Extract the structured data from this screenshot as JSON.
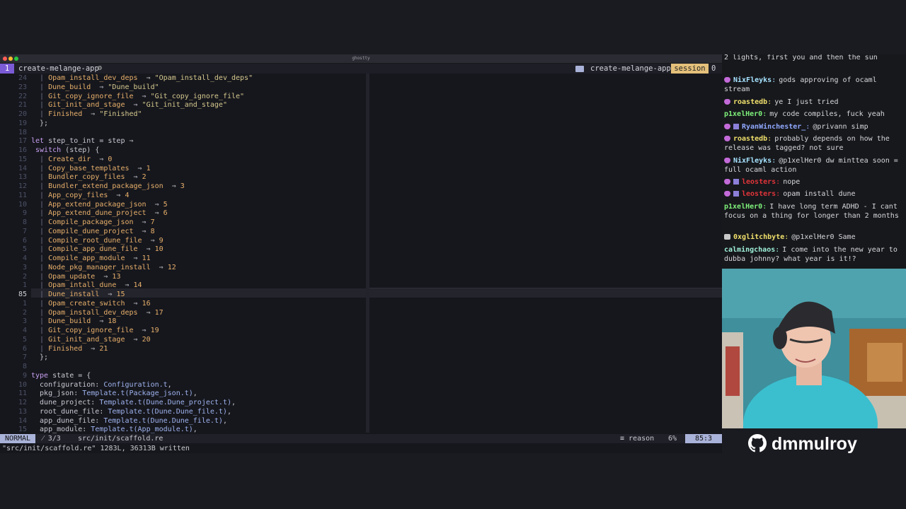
{
  "window": {
    "title": "ghostty"
  },
  "tmux": {
    "window_index": "1",
    "window_name": "create-melange-app",
    "right_name": "create-melange-app",
    "session_label": "session",
    "session_number": "0"
  },
  "editor": {
    "lines": [
      {
        "ln": "24",
        "segs": [
          [
            "pipe",
            "  | "
          ],
          [
            "ctor",
            "Opam_install_dev_deps"
          ],
          [
            "",
            "  ⇒ "
          ],
          [
            "str",
            "\"Opam_install_dev_deps\""
          ]
        ]
      },
      {
        "ln": "23",
        "segs": [
          [
            "pipe",
            "  | "
          ],
          [
            "ctor",
            "Dune_build"
          ],
          [
            "",
            "  ⇒ "
          ],
          [
            "str",
            "\"Dune_build\""
          ]
        ]
      },
      {
        "ln": "22",
        "segs": [
          [
            "pipe",
            "  | "
          ],
          [
            "ctor",
            "Git_copy_ignore_file"
          ],
          [
            "",
            "  ⇒ "
          ],
          [
            "str",
            "\"Git_copy_ignore_file\""
          ]
        ]
      },
      {
        "ln": "21",
        "segs": [
          [
            "pipe",
            "  | "
          ],
          [
            "ctor",
            "Git_init_and_stage"
          ],
          [
            "",
            "  ⇒ "
          ],
          [
            "str",
            "\"Git_init_and_stage\""
          ]
        ]
      },
      {
        "ln": "20",
        "segs": [
          [
            "pipe",
            "  | "
          ],
          [
            "ctor",
            "Finished"
          ],
          [
            "",
            "  ⇒ "
          ],
          [
            "str",
            "\"Finished\""
          ]
        ]
      },
      {
        "ln": "19",
        "segs": [
          [
            "",
            "  };"
          ]
        ]
      },
      {
        "ln": "18",
        "segs": [
          [
            "",
            ""
          ]
        ]
      },
      {
        "ln": "17",
        "segs": [
          [
            "kw",
            "let "
          ],
          [
            "",
            "step_to_int = step ⇒"
          ]
        ]
      },
      {
        "ln": "16",
        "segs": [
          [
            "kw",
            " switch"
          ],
          [
            "",
            " (step) {"
          ]
        ]
      },
      {
        "ln": "15",
        "segs": [
          [
            "pipe",
            "  | "
          ],
          [
            "ctor",
            "Create_dir"
          ],
          [
            "",
            "  ⇒ "
          ],
          [
            "num",
            "0"
          ]
        ]
      },
      {
        "ln": "14",
        "segs": [
          [
            "pipe",
            "  | "
          ],
          [
            "ctor",
            "Copy_base_templates"
          ],
          [
            "",
            "  ⇒ "
          ],
          [
            "num",
            "1"
          ]
        ]
      },
      {
        "ln": "13",
        "segs": [
          [
            "pipe",
            "  | "
          ],
          [
            "ctor",
            "Bundler_copy_files"
          ],
          [
            "",
            "  ⇒ "
          ],
          [
            "num",
            "2"
          ]
        ]
      },
      {
        "ln": "12",
        "segs": [
          [
            "pipe",
            "  | "
          ],
          [
            "ctor",
            "Bundler_extend_package_json"
          ],
          [
            "",
            "  ⇒ "
          ],
          [
            "num",
            "3"
          ]
        ]
      },
      {
        "ln": "11",
        "segs": [
          [
            "pipe",
            "  | "
          ],
          [
            "ctor",
            "App_copy_files"
          ],
          [
            "",
            "  ⇒ "
          ],
          [
            "num",
            "4"
          ]
        ]
      },
      {
        "ln": "10",
        "segs": [
          [
            "pipe",
            "  | "
          ],
          [
            "ctor",
            "App_extend_package_json"
          ],
          [
            "",
            "  ⇒ "
          ],
          [
            "num",
            "5"
          ]
        ]
      },
      {
        "ln": "9",
        "segs": [
          [
            "pipe",
            "  | "
          ],
          [
            "ctor",
            "App_extend_dune_project"
          ],
          [
            "",
            "  ⇒ "
          ],
          [
            "num",
            "6"
          ]
        ]
      },
      {
        "ln": "8",
        "segs": [
          [
            "pipe",
            "  | "
          ],
          [
            "ctor",
            "Compile_package_json"
          ],
          [
            "",
            "  ⇒ "
          ],
          [
            "num",
            "7"
          ]
        ]
      },
      {
        "ln": "7",
        "segs": [
          [
            "pipe",
            "  | "
          ],
          [
            "ctor",
            "Compile_dune_project"
          ],
          [
            "",
            "  ⇒ "
          ],
          [
            "num",
            "8"
          ]
        ]
      },
      {
        "ln": "6",
        "segs": [
          [
            "pipe",
            "  | "
          ],
          [
            "ctor",
            "Compile_root_dune_file"
          ],
          [
            "",
            "  ⇒ "
          ],
          [
            "num",
            "9"
          ]
        ]
      },
      {
        "ln": "5",
        "segs": [
          [
            "pipe",
            "  | "
          ],
          [
            "ctor",
            "Compile_app_dune_file"
          ],
          [
            "",
            "  ⇒ "
          ],
          [
            "num",
            "10"
          ]
        ]
      },
      {
        "ln": "4",
        "segs": [
          [
            "pipe",
            "  | "
          ],
          [
            "ctor",
            "Compile_app_module"
          ],
          [
            "",
            "  ⇒ "
          ],
          [
            "num",
            "11"
          ]
        ]
      },
      {
        "ln": "3",
        "segs": [
          [
            "pipe",
            "  | "
          ],
          [
            "ctor",
            "Node_pkg_manager_install"
          ],
          [
            "",
            "  ⇒ "
          ],
          [
            "num",
            "12"
          ]
        ]
      },
      {
        "ln": "2",
        "segs": [
          [
            "pipe",
            "  | "
          ],
          [
            "ctor",
            "Opam_update"
          ],
          [
            "",
            "  ⇒ "
          ],
          [
            "num",
            "13"
          ]
        ]
      },
      {
        "ln": "1",
        "segs": [
          [
            "pipe",
            "  | "
          ],
          [
            "ctor",
            "Opam_intall_dune"
          ],
          [
            "",
            "  ⇒ "
          ],
          [
            "num",
            "14"
          ]
        ]
      },
      {
        "ln": "85",
        "cur": true,
        "segs": [
          [
            "pipe",
            "  | "
          ],
          [
            "ctor",
            "Dune_install"
          ],
          [
            "",
            "  ⇒ "
          ],
          [
            "num",
            "15"
          ]
        ]
      },
      {
        "ln": "1",
        "segs": [
          [
            "pipe",
            "  | "
          ],
          [
            "ctor",
            "Opam_create_switch"
          ],
          [
            "",
            "  ⇒ "
          ],
          [
            "num",
            "16"
          ]
        ]
      },
      {
        "ln": "2",
        "segs": [
          [
            "pipe",
            "  | "
          ],
          [
            "ctor",
            "Opam_install_dev_deps"
          ],
          [
            "",
            "  ⇒ "
          ],
          [
            "num",
            "17"
          ]
        ]
      },
      {
        "ln": "3",
        "segs": [
          [
            "pipe",
            "  | "
          ],
          [
            "ctor",
            "Dune_build"
          ],
          [
            "",
            "  ⇒ "
          ],
          [
            "num",
            "18"
          ]
        ]
      },
      {
        "ln": "4",
        "segs": [
          [
            "pipe",
            "  | "
          ],
          [
            "ctor",
            "Git_copy_ignore_file"
          ],
          [
            "",
            "  ⇒ "
          ],
          [
            "num",
            "19"
          ]
        ]
      },
      {
        "ln": "5",
        "segs": [
          [
            "pipe",
            "  | "
          ],
          [
            "ctor",
            "Git_init_and_stage"
          ],
          [
            "",
            "  ⇒ "
          ],
          [
            "num",
            "20"
          ]
        ]
      },
      {
        "ln": "6",
        "segs": [
          [
            "pipe",
            "  | "
          ],
          [
            "ctor",
            "Finished"
          ],
          [
            "",
            "  ⇒ "
          ],
          [
            "num",
            "21"
          ]
        ]
      },
      {
        "ln": "7",
        "segs": [
          [
            "",
            "  };"
          ]
        ]
      },
      {
        "ln": "8",
        "segs": [
          [
            "",
            ""
          ]
        ]
      },
      {
        "ln": "9",
        "segs": [
          [
            "kw",
            "type "
          ],
          [
            "",
            "state = {"
          ]
        ]
      },
      {
        "ln": "10",
        "segs": [
          [
            "",
            "  configuration: "
          ],
          [
            "mod",
            "Configuration.t"
          ],
          [
            "",
            ","
          ]
        ]
      },
      {
        "ln": "11",
        "segs": [
          [
            "",
            "  pkg_json: "
          ],
          [
            "mod",
            "Template.t(Package_json.t)"
          ],
          [
            "",
            ","
          ]
        ]
      },
      {
        "ln": "12",
        "segs": [
          [
            "",
            "  dune_project: "
          ],
          [
            "mod",
            "Template.t(Dune.Dune_project.t)"
          ],
          [
            "",
            ","
          ]
        ]
      },
      {
        "ln": "13",
        "segs": [
          [
            "",
            "  root_dune_file: "
          ],
          [
            "mod",
            "Template.t(Dune.Dune_file.t)"
          ],
          [
            "",
            ","
          ]
        ]
      },
      {
        "ln": "14",
        "segs": [
          [
            "",
            "  app_dune_file: "
          ],
          [
            "mod",
            "Template.t(Dune.Dune_file.t)"
          ],
          [
            "",
            ","
          ]
        ]
      },
      {
        "ln": "15",
        "segs": [
          [
            "",
            "  app_module: "
          ],
          [
            "mod",
            "Template.t(App_module.t)"
          ],
          [
            "",
            ","
          ]
        ]
      }
    ]
  },
  "statusline": {
    "mode": "NORMAL",
    "branch": "⁄ 3/3",
    "file": "src/init/scaffold.re",
    "filetype": "≡ reason",
    "percent": "6%",
    "position": "85:3"
  },
  "cmdline": "\"src/init/scaffold.re\" 1283L, 36313B written",
  "chat": {
    "messages": [
      {
        "user": "",
        "text": "2 lights, first you and then the sun",
        "color": "#d8d8dc",
        "badge": ""
      },
      {
        "user": "NixFleyks",
        "text": "gods approving of ocaml stream",
        "color": "#a6e3ff",
        "badge": "heart"
      },
      {
        "user": "roastedb",
        "text": "ye I just tried",
        "color": "#f0e06b",
        "badge": "heart"
      },
      {
        "user": "p1xelHer0",
        "text": "my code compiles, fuck yeah",
        "color": "#7ef07a",
        "badge": ""
      },
      {
        "user": "RyanWinchester_",
        "text": "@privann simp",
        "color": "#8fa8ff",
        "badge": "heart2"
      },
      {
        "user": "roastedb",
        "text": "probably depends on how the release was tagged? not sure",
        "color": "#f0e06b",
        "badge": "heart"
      },
      {
        "user": "NixFleyks",
        "text": "@p1xelHer0 dw minttea soon = full ocaml action",
        "color": "#a6e3ff",
        "badge": "heart"
      },
      {
        "user": "leosters",
        "text": "nope",
        "color": "#e0353a",
        "badge": "heart2"
      },
      {
        "user": "leosters",
        "text": "opam install dune",
        "color": "#e0353a",
        "badge": "heart2"
      },
      {
        "user": "p1xelHer0",
        "text": "I have long term ADHD - I cant focus on a thing for longer than 2 months",
        "color": "#7ef07a",
        "badge": ""
      },
      {
        "user": "0xglitchbyte",
        "text": "@p1xelHer0 Same",
        "color": "#f0e06b",
        "badge": "cup"
      },
      {
        "user": "calmingchaos",
        "text": "I come into the new year to dubba johnny? what year is it!?",
        "color": "#9ef0d8",
        "badge": ""
      }
    ]
  },
  "webcam": {
    "handle": "dmmulroy",
    "icon": "github-icon"
  }
}
